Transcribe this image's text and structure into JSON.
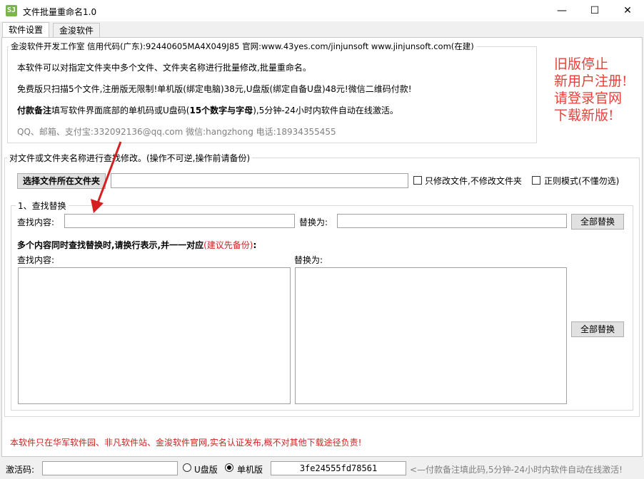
{
  "window": {
    "icon_text": "SJ",
    "title": "文件批量重命名1.0",
    "minimize": "—",
    "maximize": "☐",
    "close": "✕"
  },
  "tabs": [
    {
      "label": "软件设置"
    },
    {
      "label": "金浚软件"
    }
  ],
  "info": {
    "legend": "金浚软件开发工作室 信用代码(广东):92440605MA4X049J85 官网:www.43yes.com/jinjunsoft  www.jinjunsoft.com(在建)",
    "line1": "本软件可以对指定文件夹中多个文件、文件夹名称进行批量修改,批量重命名。",
    "line2": "免费版只扫描5个文件,注册版无限制!单机版(绑定电脑)38元,U盘版(绑定自备U盘)48元!微信二维码付款!",
    "line3_bold": "付款备注",
    "line3_a": "填写软件界面底部的单机码或U盘码(",
    "line3_bold2": "15个数字与字母",
    "line3_b": "),5分钟-24小时内软件自动在线激活。",
    "contact": "QQ、邮箱、支付宝:332092136@qq.com    微信:hangzhong    电话:18934355455"
  },
  "notice": [
    "旧版停止",
    "新用户注册!",
    "请登录官网",
    "下载新版!"
  ],
  "main": {
    "legend": "对文件或文件夹名称进行查找修改。(操作不可逆,操作前请备份)",
    "choose_folder_button": "选择文件所在文件夹",
    "folder_path": "",
    "only_files_label": "只修改文件,不修改文件夹",
    "regex_label": "正则模式(不懂勿选)",
    "find_replace": {
      "legend": "1、查找替换",
      "find_label": "查找内容:",
      "find_value": "",
      "replace_label": "替换为:",
      "replace_value": "",
      "replace_all_button": "全部替换",
      "multi_title": "多个内容同时查找替换时,请换行表示,并一一对应",
      "multi_hint": "(建议先备份)",
      "multi_colon": ":",
      "multi_find_label": "查找内容:",
      "multi_replace_label": "替换为:",
      "multi_replace_all_button": "全部替换"
    }
  },
  "footer": {
    "disclaimer": "本软件只在华军软件园、非凡软件站、金浚软件官网,实名认证发布,概不对其他下载途径负责!",
    "activation_label": "激活码:",
    "activation_value": "",
    "usb_label": "U盘版",
    "standalone_label": "单机版",
    "machine_code": "3fe24555fd78561",
    "hint": "<—付款备注填此码,5分钟-24小时内软件自动在线激活!"
  },
  "colors": {
    "notice": "#e8403a",
    "arrow": "#d42020",
    "hint_red": "#cc2222"
  }
}
